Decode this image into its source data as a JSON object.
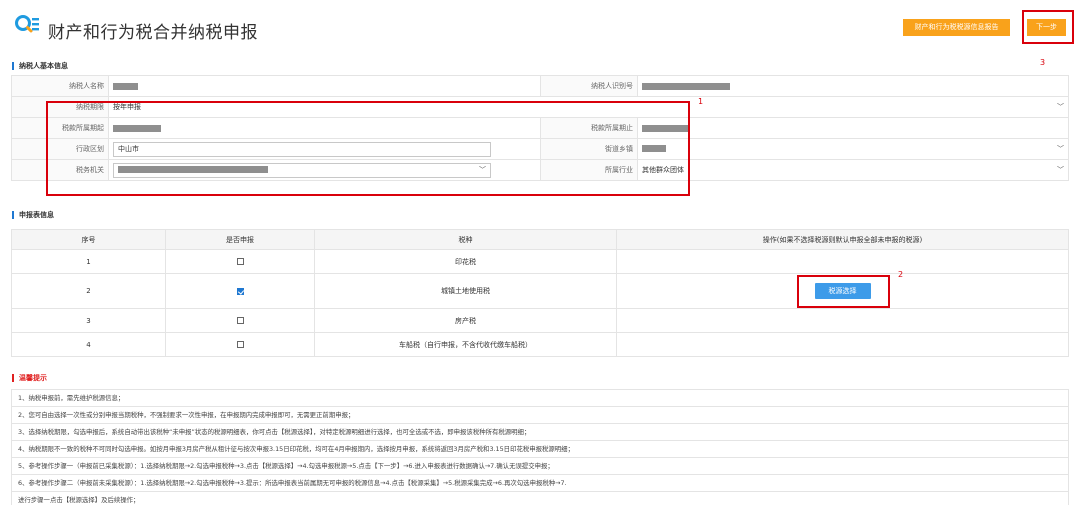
{
  "header": {
    "title": "财产和行为税合并纳税申报",
    "report_button": "财产和行为税税源信息报告",
    "next_button": "下一步"
  },
  "basic_info": {
    "section_title": "纳税人基本信息",
    "taxpayer_name_label": "纳税人名称",
    "taxpayer_id_label": "纳税人识别号",
    "period_label": "纳税期限",
    "period_value": "按年申报",
    "start_label": "税款所属期起",
    "end_label": "税款所属期止",
    "district_label": "行政区划",
    "district_value": "中山市",
    "street_label": "街道乡镇",
    "office_label": "税务机关",
    "industry_label": "所属行业",
    "industry_value": "其他群众团体"
  },
  "declaration": {
    "section_title": "申报表信息",
    "headers": [
      "序号",
      "是否申报",
      "税种",
      "操作(如果不选择税源则默认申报全部未申报的税源)"
    ],
    "rows": [
      {
        "no": "1",
        "checked": false,
        "tax": "印花税"
      },
      {
        "no": "2",
        "checked": true,
        "tax": "城镇土地使用税"
      },
      {
        "no": "3",
        "checked": false,
        "tax": "房产税"
      },
      {
        "no": "4",
        "checked": false,
        "tax": "车船税（自行申报，不含代收代缴车船税）"
      }
    ],
    "source_button": "税源选择"
  },
  "tips": {
    "section_title": "温馨提示",
    "items": [
      "1、纳税申报前，需先维护税源信息；",
      "2、您可自由选择一次性或分别申报当期税种，不强制要求一次性申报，在申报期内完成申报即可，无需更正前期申报；",
      "3、选择纳税期限，勾选申报后，系统自动带出该税种“未申报”状态的税源明细表，你可点击【税源选择】，对特定税源明细进行选择，也可全选或不选，即申报该税种所有税源明细；",
      "4、纳税期限不一致的税种不可同时勾选申报。如按月申报3月房产税从租计征与按次申报3.15日印花税，均可在4月申报期内，选择按月申报，系统将返回3月房产税和3.15日印花税申报税源明细；",
      "5、参考操作步骤一（申报前已采集税源）：1.选择纳税期限→2.勾选申报税种→3.点击【税源选择】→4.勾选申报税源→5.点击【下一步】→6.进入申报表进行数据确认→7.确认无误提交申报；",
      "6、参考操作步骤二（申报前未采集税源）：1.选择纳税期限→2.勾选申报税种→3.提示：所选申报表当前属期无可申报的税源信息→4.点击【税源采集】→5.税源采集完成→6.再次勾选申报税种→7.",
      "进行步骤一点击【税源选择】及后续操作；"
    ]
  },
  "annotations": [
    "1",
    "2",
    "3"
  ],
  "colors": {
    "accent_blue": "#1f78d1",
    "button_orange": "#f9a21b",
    "annotation_red": "#d9000b",
    "button_blue": "#3d9be9"
  }
}
